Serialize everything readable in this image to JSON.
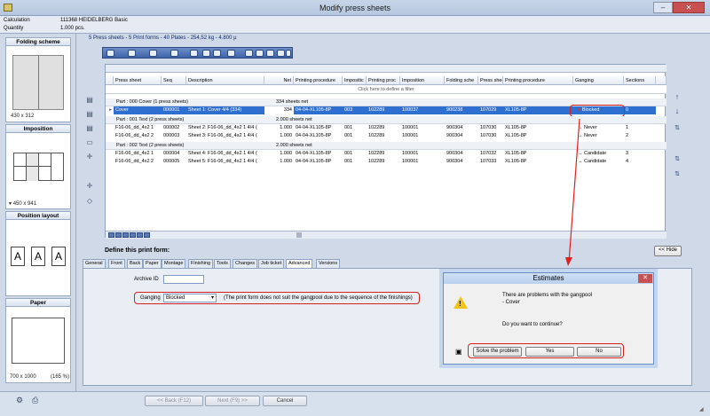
{
  "window": {
    "title": "Modify press sheets"
  },
  "info": {
    "calc_label": "Calculation",
    "calc_value": "111368 HEIDELBERG Basic",
    "qty_label": "Quantity",
    "qty_value": "1.000 pcs."
  },
  "left": {
    "folding": {
      "title": "Folding scheme",
      "dims": "430 x 312"
    },
    "imposition": {
      "title": "Imposition",
      "dims": "450 x 941"
    },
    "position": {
      "title": "Position layout",
      "letters": [
        "A",
        "A",
        "A"
      ]
    },
    "paper": {
      "title": "Paper",
      "dims": "700 x 1000",
      "pct": "(165 %)"
    }
  },
  "summary": "5 Press sheets - 5 Print forms - 40 Plates - 254,52 kg - 4.800 µ",
  "grid": {
    "columns": [
      "Press sheet",
      "Seq",
      "Description",
      "Net",
      "Printing procedure",
      "Impositic",
      "Printing proc",
      "Imposition",
      "Folding sche",
      "Press shee",
      "Printing procedure",
      "Ganging",
      "Sections"
    ],
    "filter": "Click here to define a filter",
    "group1": {
      "label": "Part : 000 Cover (1 press sheets)",
      "net": "334 sheets net"
    },
    "cover": {
      "sheet": "Cover",
      "seq": "000001",
      "desc": "Sheet 1: Cover 4/4 (334)",
      "net": "334",
      "proc": "04-04-XL105-8P",
      "imp": "003",
      "pp": "102289",
      "impo": "100037",
      "fold": "900238",
      "press": "107029",
      "proc2": "XL105-8P",
      "gang": "Blocked",
      "sec": "0"
    },
    "group2": {
      "label": "Part : 001 Text (2 press sheets)",
      "net": "2.000 sheets net"
    },
    "text1": [
      {
        "sheet": "F16-06_dd_4x2 1",
        "seq": "000002",
        "desc": "Sheet 2: F16-06_dd_4x2 1 4/4 (",
        "net": "1.000",
        "proc": "04-04-XL105-8P",
        "imp": "001",
        "pp": "102289",
        "impo": "100001",
        "fold": "900304",
        "press": "107030",
        "proc2": "XL105-8P",
        "gang": "Never",
        "sec": "1"
      },
      {
        "sheet": "F16-06_dd_4x2 2",
        "seq": "000003",
        "desc": "Sheet 3: F16-06_dd_4x2 1 4/4 (",
        "net": "1.000",
        "proc": "04-04-XL105-8P",
        "imp": "001",
        "pp": "102289",
        "impo": "100001",
        "fold": "900304",
        "press": "107030",
        "proc2": "XL105-8P",
        "gang": "Never",
        "sec": "2"
      }
    ],
    "group3": {
      "label": "Part : 002 Text (2 press sheets)",
      "net": "2.000 sheets net"
    },
    "text2": [
      {
        "sheet": "F16-06_dd_4x2 1",
        "seq": "000004",
        "desc": "Sheet 4: F16-06_dd_4x2 1 4/4 (",
        "net": "1.000",
        "proc": "04-04-XL105-8P",
        "imp": "001",
        "pp": "102289",
        "impo": "100001",
        "fold": "900304",
        "press": "107032",
        "proc2": "XL105-8P",
        "gang": "Candidate",
        "sec": "3"
      },
      {
        "sheet": "F16-06_dd_4x2 2",
        "seq": "000005",
        "desc": "Sheet 5: F16-06_dd_4x2 1 4/4 (",
        "net": "1.000",
        "proc": "04-04-XL105-8P",
        "imp": "001",
        "pp": "102289",
        "impo": "100001",
        "fold": "900304",
        "press": "107033",
        "proc2": "XL105-8P",
        "gang": "Candidate",
        "sec": "4"
      }
    ]
  },
  "define": {
    "title": "Define this print form:",
    "hide": "<< Hide",
    "tabs": [
      "General",
      "Front",
      "Back",
      "Paper",
      "Montage",
      "Finishing",
      "Tools",
      "Changes",
      "Job ticket",
      "Advanced",
      "Versions"
    ],
    "archive_label": "Archive ID",
    "archive_value": "",
    "ganging_label": "Ganging",
    "ganging_value": "Blocked",
    "ganging_note": "(The print form does not suit the gangpool due to the sequence of the finishings)"
  },
  "dialog": {
    "title": "Estimates",
    "line1": "There are problems with the gangpool",
    "line2": "- Cover",
    "question": "Do you want to continue?",
    "solve": "Solve the problem",
    "yes": "Yes",
    "no": "No"
  },
  "nav": {
    "back": "<< Back (F12)",
    "next": "Next (F9) >>",
    "cancel": "Cancel"
  }
}
